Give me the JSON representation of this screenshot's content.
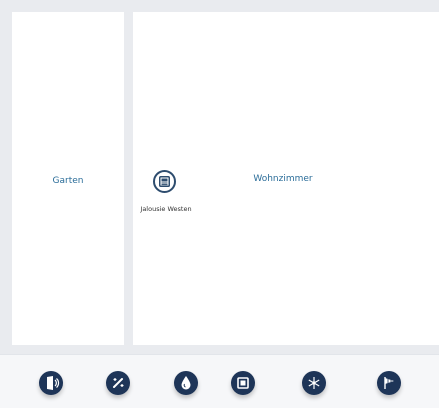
{
  "rooms": {
    "garten": {
      "label": "Garten"
    },
    "wohnzimmer": {
      "label": "Wohnzimmer"
    }
  },
  "device": {
    "label": "Jalousie Westen",
    "icon": "blind-icon"
  },
  "categories": [
    {
      "icon": "door-icon",
      "label": ""
    },
    {
      "icon": "light-icon",
      "label": ""
    },
    {
      "icon": "water-drop-icon",
      "label": ""
    },
    {
      "icon": "blind-icon",
      "label": ""
    },
    {
      "icon": "snowflake-icon",
      "label": ""
    },
    {
      "icon": "weather-icon",
      "label": ""
    }
  ],
  "colors": {
    "accent": "#2b6d99",
    "icon_dark": "#1e3558",
    "plan_background": "#e9ebef"
  }
}
